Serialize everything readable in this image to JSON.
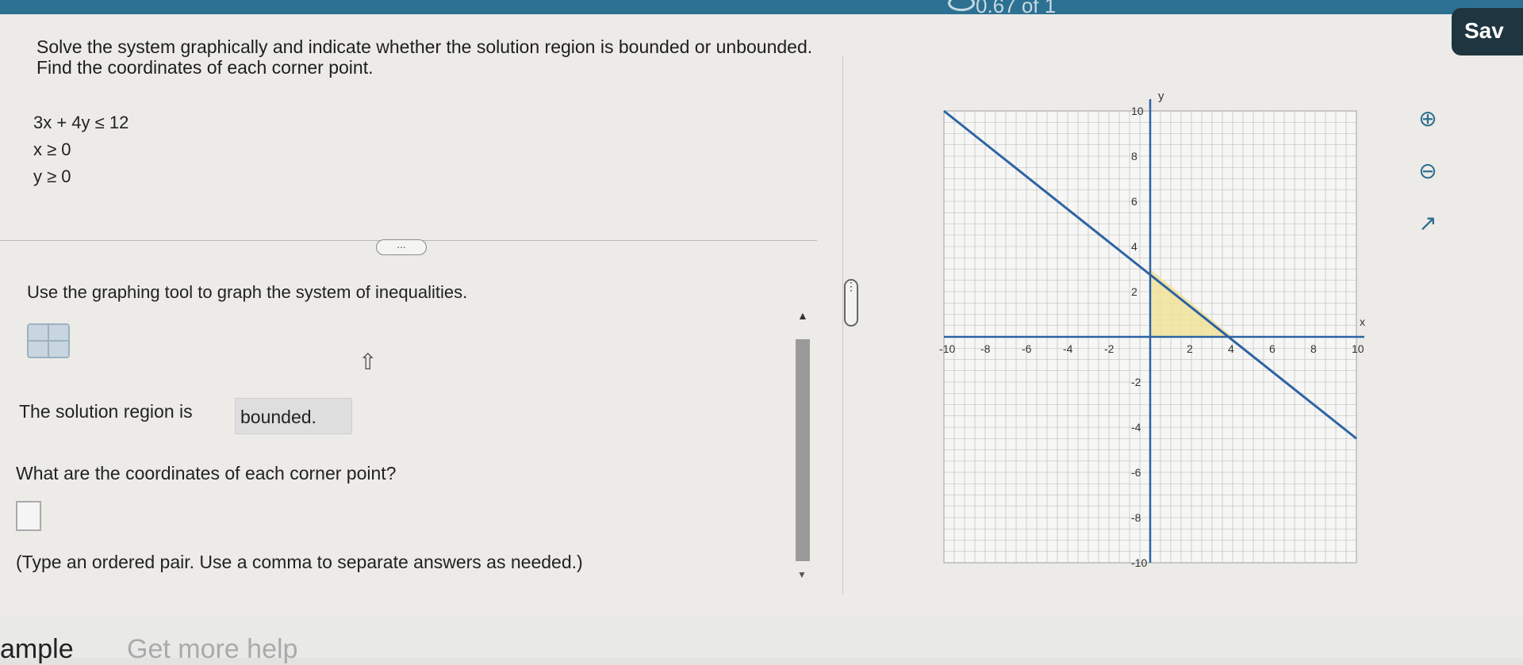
{
  "header": {
    "points": "0.67 of 1",
    "save_label": "Sav"
  },
  "question": {
    "text": "Solve the system graphically and indicate whether the solution region is bounded or unbounded. Find the coordinates of each corner point.",
    "inequalities": [
      "3x + 4y ≤ 12",
      "x ≥ 0",
      "y ≥ 0"
    ]
  },
  "more_button": "...",
  "instruction": "Use the graphing tool to graph the system of inequalities.",
  "solution": {
    "label": "The solution region is",
    "value": "bounded."
  },
  "corner_question": "What are the coordinates of each corner point?",
  "hint": "(Type an ordered pair. Use a comma to separate answers as needed.)",
  "graph": {
    "x_axis_label": "x",
    "y_axis_label": "y",
    "x_ticks": [
      "-10",
      "-8",
      "-6",
      "-4",
      "-2",
      "2",
      "4",
      "6",
      "8",
      "10"
    ],
    "y_ticks": [
      "10",
      "8",
      "6",
      "4",
      "2",
      "-2",
      "-4",
      "-6",
      "-8",
      "-10"
    ],
    "line": {
      "equation": "3x + 4y = 12",
      "color": "#2e63a3"
    },
    "shaded_region_color": "#f1e29a",
    "region_vertices": [
      [
        0,
        0
      ],
      [
        4,
        0
      ],
      [
        0,
        3
      ]
    ]
  },
  "side_icons": [
    "zoom-in-icon",
    "zoom-out-icon",
    "popout-icon"
  ],
  "bottom": {
    "left": "ample",
    "right": "Get more help"
  }
}
